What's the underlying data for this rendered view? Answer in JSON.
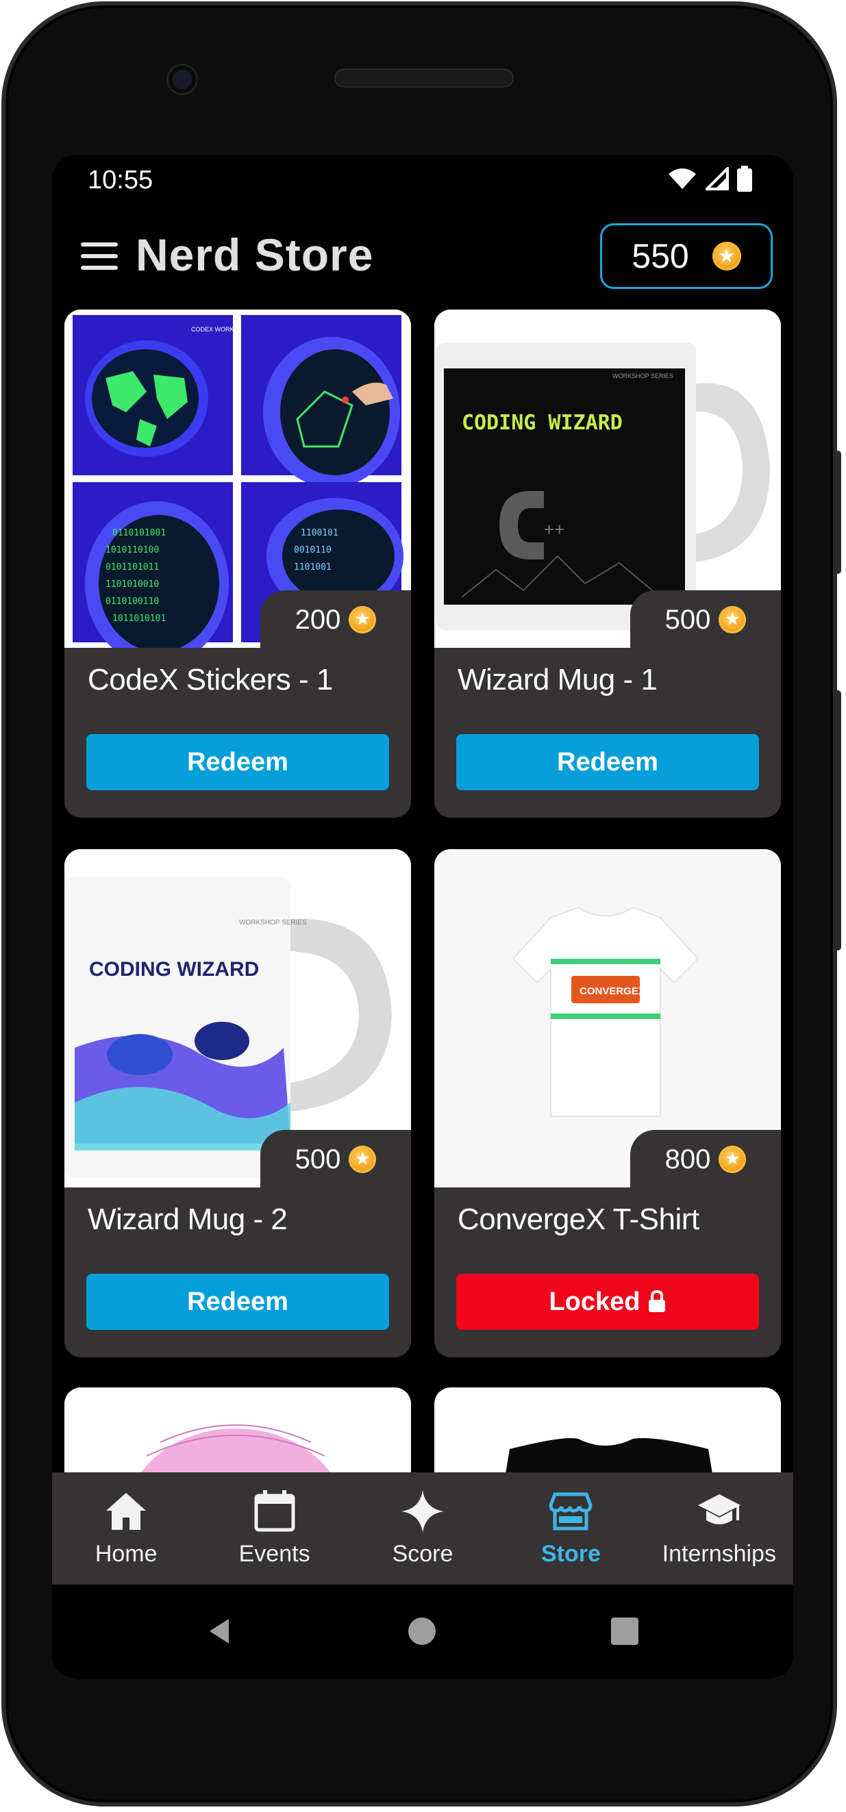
{
  "status": {
    "time": "10:55"
  },
  "header": {
    "title": "Nerd Store",
    "coin_balance": "550"
  },
  "products": [
    {
      "name": "CodeX Stickers - 1",
      "price": "200",
      "action": "Redeem",
      "locked": false,
      "image": "codex-stickers-image"
    },
    {
      "name": "Wizard Mug - 1",
      "price": "500",
      "action": "Redeem",
      "locked": false,
      "image": "wizard-mug-dark-image"
    },
    {
      "name": "Wizard Mug - 2",
      "price": "500",
      "action": "Redeem",
      "locked": false,
      "image": "wizard-mug-light-image"
    },
    {
      "name": "ConvergeX T-Shirt",
      "price": "800",
      "action": "Locked",
      "locked": true,
      "image": "convergex-tshirt-image"
    }
  ],
  "images": {
    "sticker_top_label": "CODEX WORKSHOP",
    "mug1_text": "CODING WIZARD",
    "mug1_series": "WORKSHOP SERIES",
    "mug2_text": "CODING WIZARD",
    "mug2_series": "WORKSHOP SERIES",
    "tshirt_text": "CONVERGEX"
  },
  "nav": {
    "items": [
      {
        "label": "Home",
        "icon": "home-icon"
      },
      {
        "label": "Events",
        "icon": "calendar-icon"
      },
      {
        "label": "Score",
        "icon": "sparkle-icon"
      },
      {
        "label": "Store",
        "icon": "store-icon",
        "active": true
      },
      {
        "label": "Internships",
        "icon": "graduation-cap-icon"
      }
    ]
  },
  "colors": {
    "accent": "#049fd9",
    "locked": "#f0051d",
    "card": "#353333",
    "active_nav": "#3fb4e8"
  }
}
